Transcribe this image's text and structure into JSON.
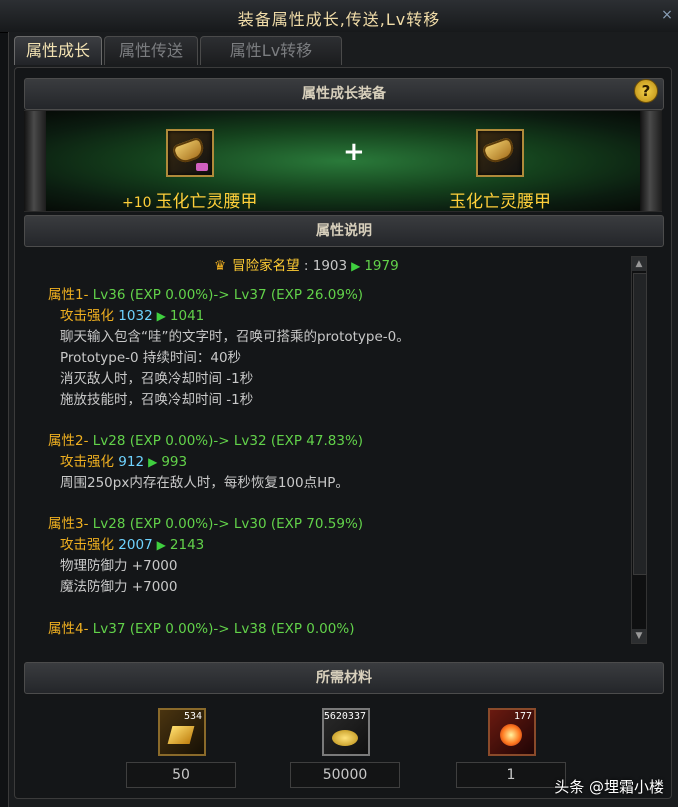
{
  "window": {
    "title": "装备属性成长,传送,Lv转移",
    "close_icon": "×"
  },
  "tabs": [
    {
      "label": "属性成长",
      "active": true
    },
    {
      "label": "属性传送",
      "active": false
    },
    {
      "label": "属性Lv转移",
      "active": false
    }
  ],
  "equipment_section": {
    "header": "属性成长装备",
    "help_icon": "?",
    "plus_sign": "+",
    "source_item": {
      "enhance": "+10",
      "name": "玉化亡灵腰甲"
    },
    "target_item": {
      "name": "玉化亡灵腰甲"
    }
  },
  "description_section": {
    "header": "属性说明",
    "fame": {
      "label": "冒险家名望",
      "from": "1903",
      "to": "1979"
    },
    "attributes": [
      {
        "title": "属性1- ",
        "progress": "Lv36 (EXP 0.00%)-> Lv37 (EXP 26.09%)",
        "stat_label": "攻击强化",
        "stat_from": "1032",
        "stat_to": "1041",
        "extra_lines": [
          "聊天输入包含“哇”的文字时，召唤可搭乘的prototype-0。",
          "Prototype-0 持续时间：40秒",
          "消灭敌人时，召唤冷却时间 -1秒",
          "施放技能时，召唤冷却时间 -1秒"
        ]
      },
      {
        "title": "属性2- ",
        "progress": "Lv28 (EXP 0.00%)-> Lv32 (EXP 47.83%)",
        "stat_label": "攻击强化",
        "stat_from": "912",
        "stat_to": "993",
        "extra_lines": [
          "周围250px内存在敌人时，每秒恢复100点HP。"
        ]
      },
      {
        "title": "属性3- ",
        "progress": "Lv28 (EXP 0.00%)-> Lv30 (EXP 70.59%)",
        "stat_label": "攻击强化",
        "stat_from": "2007",
        "stat_to": "2143",
        "extra_lines": [
          "物理防御力 +7000",
          "魔法防御力 +7000"
        ]
      },
      {
        "title": "属性4- ",
        "progress": "Lv37 (EXP 0.00%)-> Lv38 (EXP 0.00%)"
      }
    ]
  },
  "materials_section": {
    "header": "所需材料",
    "items": [
      {
        "icon": "gold-crystal-icon",
        "count": "534",
        "required": "50"
      },
      {
        "icon": "gold-coins-icon",
        "count": "5620337",
        "required": "50000"
      },
      {
        "icon": "burst-orb-icon",
        "count": "177",
        "required": "1"
      }
    ]
  },
  "watermark": "头条 @埋霜小楼"
}
